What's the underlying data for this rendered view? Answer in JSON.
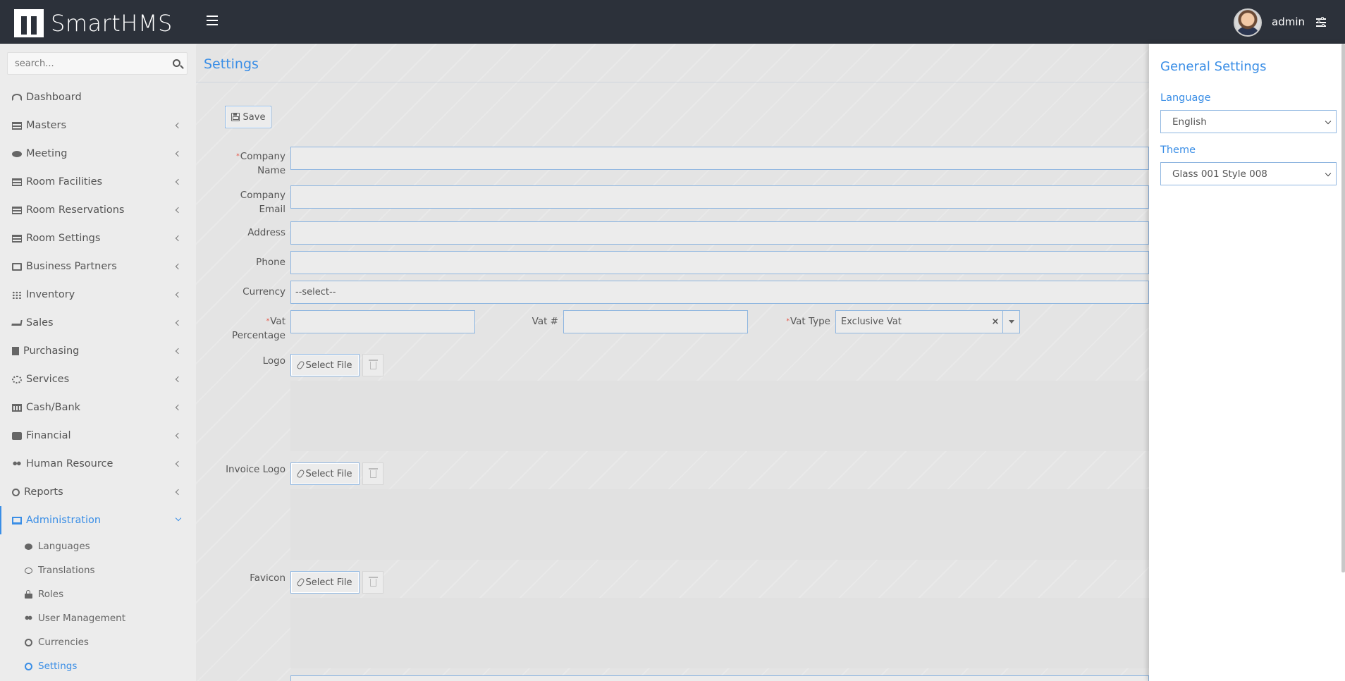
{
  "app": {
    "name": "SmartHMS",
    "user": "admin"
  },
  "search": {
    "placeholder": "search..."
  },
  "sidebar": {
    "items": [
      {
        "label": "Dashboard",
        "icon": "dashboard-icon",
        "has_children": false
      },
      {
        "label": "Masters",
        "icon": "list-icon",
        "has_children": true
      },
      {
        "label": "Meeting",
        "icon": "chat-icon",
        "has_children": true
      },
      {
        "label": "Room Facilities",
        "icon": "list-icon",
        "has_children": true
      },
      {
        "label": "Room Reservations",
        "icon": "list-icon",
        "has_children": true
      },
      {
        "label": "Room Settings",
        "icon": "list-icon",
        "has_children": true
      },
      {
        "label": "Business Partners",
        "icon": "id-card-icon",
        "has_children": true
      },
      {
        "label": "Inventory",
        "icon": "grid-icon",
        "has_children": true
      },
      {
        "label": "Sales",
        "icon": "cart-icon",
        "has_children": true
      },
      {
        "label": "Purchasing",
        "icon": "document-icon",
        "has_children": true
      },
      {
        "label": "Services",
        "icon": "gears-icon",
        "has_children": true
      },
      {
        "label": "Cash/Bank",
        "icon": "bank-icon",
        "has_children": true
      },
      {
        "label": "Financial",
        "icon": "briefcase-icon",
        "has_children": true
      },
      {
        "label": "Human Resource",
        "icon": "users-icon",
        "has_children": true
      },
      {
        "label": "Reports",
        "icon": "circle-icon",
        "has_children": true
      },
      {
        "label": "Administration",
        "icon": "monitor-icon",
        "has_children": true,
        "active": true
      }
    ],
    "admin_submenu": [
      {
        "label": "Languages",
        "icon": "chat-icon"
      },
      {
        "label": "Translations",
        "icon": "chat-outline-icon"
      },
      {
        "label": "Roles",
        "icon": "lock-icon"
      },
      {
        "label": "User Management",
        "icon": "users-icon"
      },
      {
        "label": "Currencies",
        "icon": "circle-icon"
      },
      {
        "label": "Settings",
        "icon": "circle-icon",
        "active": true
      }
    ]
  },
  "page": {
    "title": "Settings",
    "save_label": "Save"
  },
  "form": {
    "company_name_label_1": "Company",
    "company_name_label_2": "Name",
    "company_name_value": "",
    "company_email_label_1": "Company",
    "company_email_label_2": "Email",
    "company_email_value": "",
    "address_label": "Address",
    "address_value": "",
    "phone_label": "Phone",
    "phone_value": "",
    "currency_label": "Currency",
    "currency_value": "--select--",
    "vat_percentage_label_1": "Vat",
    "vat_percentage_label_2": "Percentage",
    "vat_percentage_value": "",
    "vat_no_label": "Vat #",
    "vat_no_value": "",
    "vat_type_label": "Vat Type",
    "vat_type_value": "Exclusive Vat",
    "vat_type_clear": "×",
    "logo_label": "Logo",
    "invoice_logo_label": "Invoice Logo",
    "favicon_label": "Favicon",
    "select_file_label": "Select File",
    "required_marker": "*"
  },
  "panel": {
    "title": "General Settings",
    "language_label": "Language",
    "language_value": "English",
    "theme_label": "Theme",
    "theme_value": "Glass 001 Style 008"
  },
  "colors": {
    "accent": "#3a8ee6",
    "topbar": "#2c313a",
    "required": "#e74c3c"
  }
}
